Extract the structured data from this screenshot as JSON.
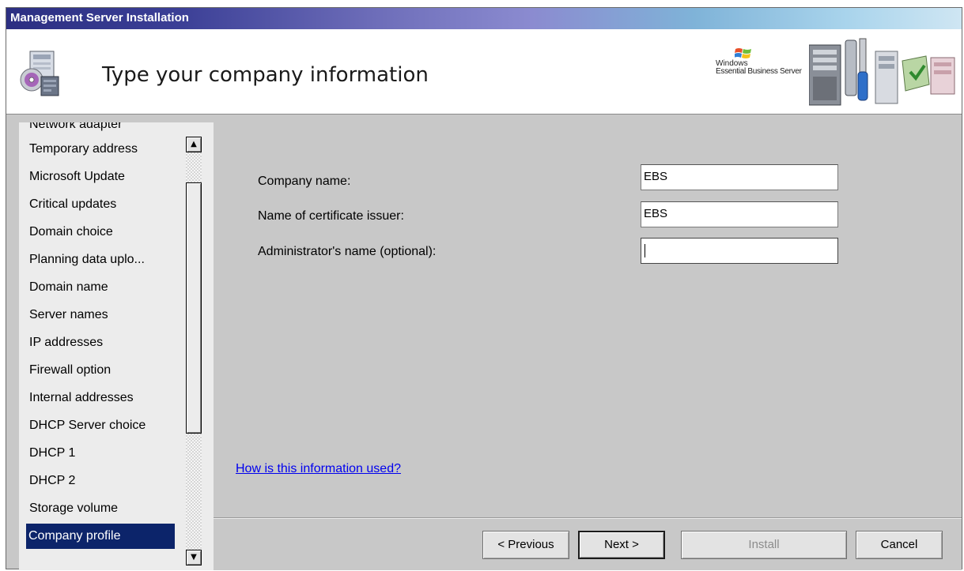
{
  "window": {
    "title": "Management Server Installation"
  },
  "header": {
    "title": "Type your company information",
    "logo_line1": "Windows",
    "logo_line2": "Essential Business Server"
  },
  "sidebar": {
    "partial_item": "Network adapter",
    "items": [
      {
        "label": "Temporary address",
        "selected": false
      },
      {
        "label": "Microsoft Update",
        "selected": false
      },
      {
        "label": "Critical updates",
        "selected": false
      },
      {
        "label": "Domain choice",
        "selected": false
      },
      {
        "label": "Planning data uplo...",
        "selected": false
      },
      {
        "label": "Domain name",
        "selected": false
      },
      {
        "label": "Server names",
        "selected": false
      },
      {
        "label": "IP addresses",
        "selected": false
      },
      {
        "label": "Firewall option",
        "selected": false
      },
      {
        "label": "Internal addresses",
        "selected": false
      },
      {
        "label": "DHCP Server choice",
        "selected": false
      },
      {
        "label": "DHCP 1",
        "selected": false
      },
      {
        "label": "DHCP 2",
        "selected": false
      },
      {
        "label": "Storage volume",
        "selected": false
      },
      {
        "label": "Company profile",
        "selected": true
      }
    ]
  },
  "form": {
    "company_name_label": "Company name:",
    "company_name_value": "EBS",
    "issuer_label": "Name of certificate issuer:",
    "issuer_value": "EBS",
    "admin_label": "Administrator's name (optional):",
    "admin_value": ""
  },
  "help_link": "How is this information used?",
  "buttons": {
    "previous": "< Previous",
    "next": "Next >",
    "install": "Install",
    "cancel": "Cancel"
  },
  "colors": {
    "selection": "#0c246a",
    "link": "#0000ee",
    "content_bg": "#c8c8c8"
  }
}
